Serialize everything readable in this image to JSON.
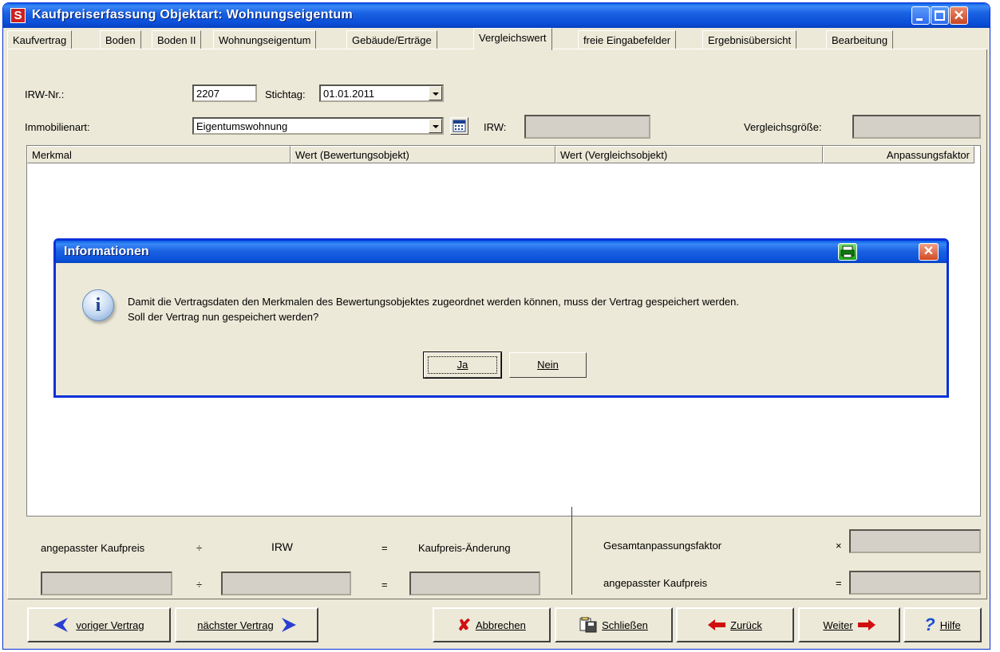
{
  "window": {
    "title": "Kaufpreiserfassung  Objektart: Wohnungseigentum",
    "app_icon_letter": "S"
  },
  "tabs": [
    {
      "label": "Kaufvertrag"
    },
    {
      "label": "Boden"
    },
    {
      "label": "Boden II"
    },
    {
      "label": "Wohnungseigentum"
    },
    {
      "label": "Gebäude/Erträge"
    },
    {
      "label": "Vergleichswert",
      "active": true
    },
    {
      "label": "freie Eingabefelder"
    },
    {
      "label": "Ergebnisübersicht"
    },
    {
      "label": "Bearbeitung"
    }
  ],
  "form": {
    "irw_nr_label": "IRW-Nr.:",
    "irw_nr_value": "2207",
    "stichtag_label": "Stichtag:",
    "stichtag_value": "01.01.2011",
    "immobilienart_label": "Immobilienart:",
    "immobilienart_value": "Eigentumswohnung",
    "irw_label": "IRW:",
    "irw_value": "",
    "vergleichsgroesse_label": "Vergleichsgröße:",
    "vergleichsgroesse_value": ""
  },
  "grid": {
    "columns": [
      "Merkmal",
      "Wert (Bewertungsobjekt)",
      "Wert (Vergleichsobjekt)",
      "Anpassungsfaktor"
    ]
  },
  "calc": {
    "angepasster_kaufpreis": "angepasster Kaufpreis",
    "div": "÷",
    "irw": "IRW",
    "eq": "=",
    "kaufpreis_aenderung": "Kaufpreis-Änderung",
    "gesamtanpassungsfaktor": "Gesamtanpassungsfaktor",
    "mul": "×",
    "angepasster_kaufpreis_right": "angepasster Kaufpreis"
  },
  "buttons": {
    "voriger": "voriger Vertrag",
    "naechster": "nächster Vertrag",
    "abbrechen": "Abbrechen",
    "schliessen": "Schließen",
    "zurueck": "Zurück",
    "weiter": "Weiter",
    "hilfe": "Hilfe"
  },
  "dialog": {
    "title": "Informationen",
    "line1": "Damit die Vertragsdaten den Merkmalen des Bewertungsobjektes zugeordnet werden können, muss der Vertrag gespeichert werden.",
    "line2": "Soll der Vertrag nun gespeichert werden?",
    "ja": "Ja",
    "nein": "Nein"
  },
  "colors": {
    "title_blue": "#0a4fd8",
    "window_bg": "#ece9d8",
    "arrow_blue": "#2a3fd0",
    "arrow_red": "#d01010"
  }
}
